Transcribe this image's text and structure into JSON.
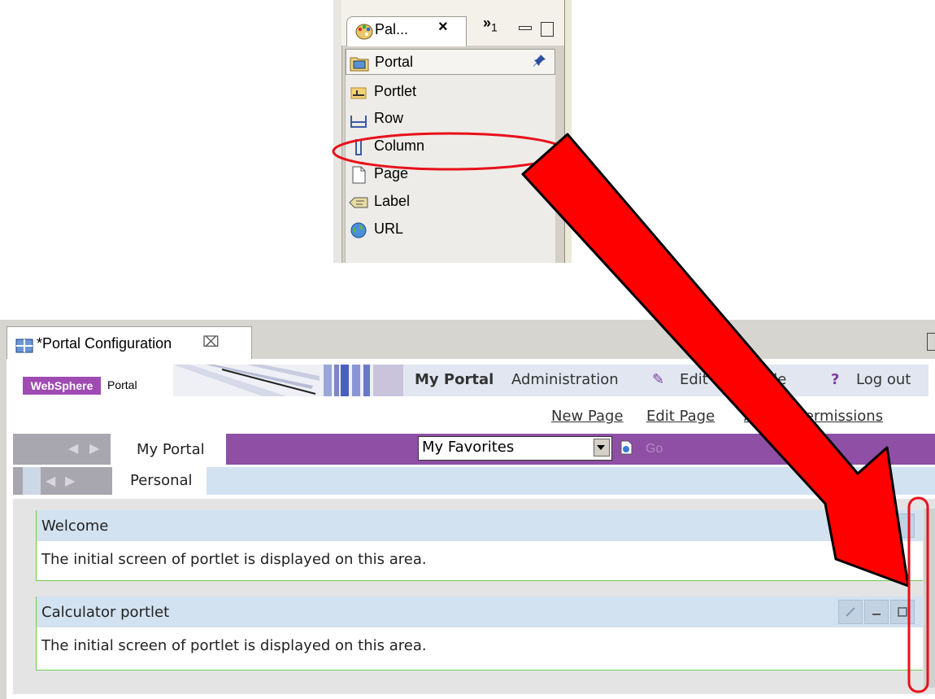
{
  "palette": {
    "tab_title": "Pal...",
    "tab_close": "×",
    "overflow": "»",
    "overflow_count": "1",
    "items": [
      {
        "label": "Portal",
        "icon": "portal-icon"
      },
      {
        "label": "Portlet",
        "icon": "portlet-icon"
      },
      {
        "label": "Row",
        "icon": "row-icon"
      },
      {
        "label": "Column",
        "icon": "column-icon"
      },
      {
        "label": "Page",
        "icon": "page-icon"
      },
      {
        "label": "Label",
        "icon": "label-icon"
      },
      {
        "label": "URL",
        "icon": "url-globe-icon"
      }
    ]
  },
  "editor": {
    "tab_title": "*Portal Configuration",
    "tab_close": "⌧"
  },
  "portal": {
    "logo_text": "WebSphere",
    "logo_suffix": "Portal",
    "top_nav": {
      "my_portal": "My Portal",
      "administration": "Administration",
      "edit_profile": "Edit my profile",
      "help": "?",
      "log_out": "Log out"
    },
    "sub_nav": {
      "new_page": "New Page",
      "edit_page": "Edit Page",
      "assign_permissions": "Assign Permissions"
    },
    "page_tab": "My Portal",
    "favorites_select": "My Favorites",
    "go_label": "Go",
    "sub_tab": "Personal",
    "portlets": [
      {
        "title": "Welcome",
        "body": "The initial screen of portlet is displayed on this area."
      },
      {
        "title": "Calculator portlet",
        "body": "The initial screen of portlet is displayed on this area."
      }
    ]
  },
  "colors": {
    "arrow": "#ff0000",
    "highlight_ellipse": "#e8101a",
    "portal_purple": "#8e4fa5",
    "nav_blue": "#d3e2f0",
    "portlet_border": "#6bcf4a"
  }
}
